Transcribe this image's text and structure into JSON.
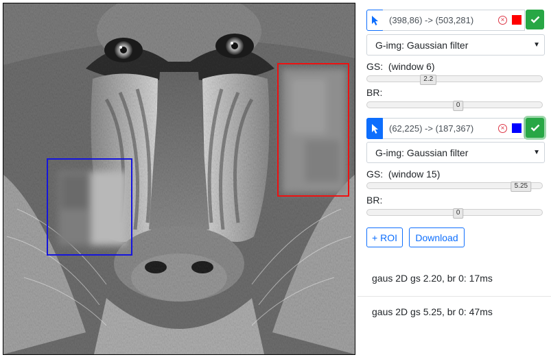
{
  "colors": {
    "roi1": "#ff0000",
    "roi2": "#0000ff",
    "primary": "#0d6efd",
    "success": "#28a745",
    "danger": "#dc3545"
  },
  "image": {
    "subject": "mandrill face, grayscale"
  },
  "rois": [
    {
      "coords": "(398,86) -> (503,281)",
      "filter": "G-img: Gaussian filter",
      "gs_label": "GS:",
      "gs_window": "(window 6)",
      "gs_value": "2.2",
      "gs_fraction": 0.35,
      "br_label": "BR:",
      "br_value": "0",
      "br_fraction": 0.52,
      "color_name": "red",
      "tool_active": false,
      "ok_focused": false
    },
    {
      "coords": "(62,225) -> (187,367)",
      "filter": "G-img: Gaussian filter",
      "gs_label": "GS:",
      "gs_window": "(window 15)",
      "gs_value": "5.25",
      "gs_fraction": 0.88,
      "br_label": "BR:",
      "br_value": "0",
      "br_fraction": 0.52,
      "color_name": "blue",
      "tool_active": true,
      "ok_focused": true
    }
  ],
  "buttons": {
    "add_roi": "+ ROI",
    "download": "Download"
  },
  "results": [
    "gaus 2D gs 2.20, br 0: 17ms",
    "gaus 2D gs 5.25, br 0: 47ms"
  ],
  "icons": {
    "tool": "cursor-arrow-icon",
    "delete": "circle-x-icon",
    "confirm": "checkmark-icon",
    "dropdown": "caret-down-icon"
  }
}
